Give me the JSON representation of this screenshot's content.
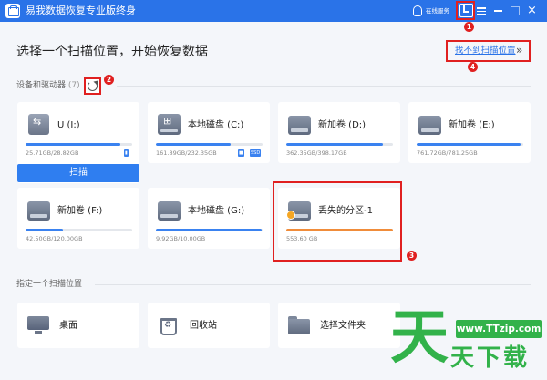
{
  "titlebar": {
    "title": "易我数据恢复专业版终身",
    "support_label": "在线服务",
    "close_glyph": "×",
    "accent_color": "#2a73e8"
  },
  "header": {
    "title": "选择一个扫描位置，开始恢复数据",
    "not_found_link": "找不到扫描位置",
    "chevron": "»"
  },
  "devices_section": {
    "label": "设备和驱动器",
    "count": "(7)",
    "drives": [
      {
        "name": "U (I:)",
        "size": "25.71GB/28.82GB",
        "usage": 0.89,
        "icon": "usb-drive-icon",
        "scan_label": "扫描"
      },
      {
        "name": "本地磁盘 (C:)",
        "size": "161.89GB/232.35GB",
        "usage": 0.7,
        "icon": "windows-drive-icon",
        "tags": [
          "■",
          "SSD"
        ]
      },
      {
        "name": "新加卷 (D:)",
        "size": "362.35GB/398.17GB",
        "usage": 0.91,
        "icon": "hard-drive-icon"
      },
      {
        "name": "新加卷 (E:)",
        "size": "761.72GB/781.25GB",
        "usage": 0.975,
        "icon": "hard-drive-icon"
      },
      {
        "name": "新加卷 (F:)",
        "size": "42.50GB/120.00GB",
        "usage": 0.354,
        "icon": "hard-drive-icon"
      },
      {
        "name": "本地磁盘 (G:)",
        "size": "9.92GB/10.00GB",
        "usage": 0.99,
        "icon": "hard-drive-icon"
      },
      {
        "name": "丢失的分区-1",
        "size": "553.60 GB",
        "usage": 1.0,
        "icon": "lost-partition-icon",
        "bar_color": "#f08c3a"
      }
    ]
  },
  "locations_section": {
    "label": "指定一个扫描位置",
    "items": [
      {
        "label": "桌面",
        "icon": "desktop-icon"
      },
      {
        "label": "回收站",
        "icon": "recycle-bin-icon"
      },
      {
        "label": "选择文件夹",
        "icon": "folder-icon"
      }
    ]
  },
  "markers": [
    "1",
    "2",
    "3",
    "4"
  ],
  "watermark": {
    "big_char": "天",
    "url": "www.TTzip.com",
    "brand": "天下载"
  }
}
